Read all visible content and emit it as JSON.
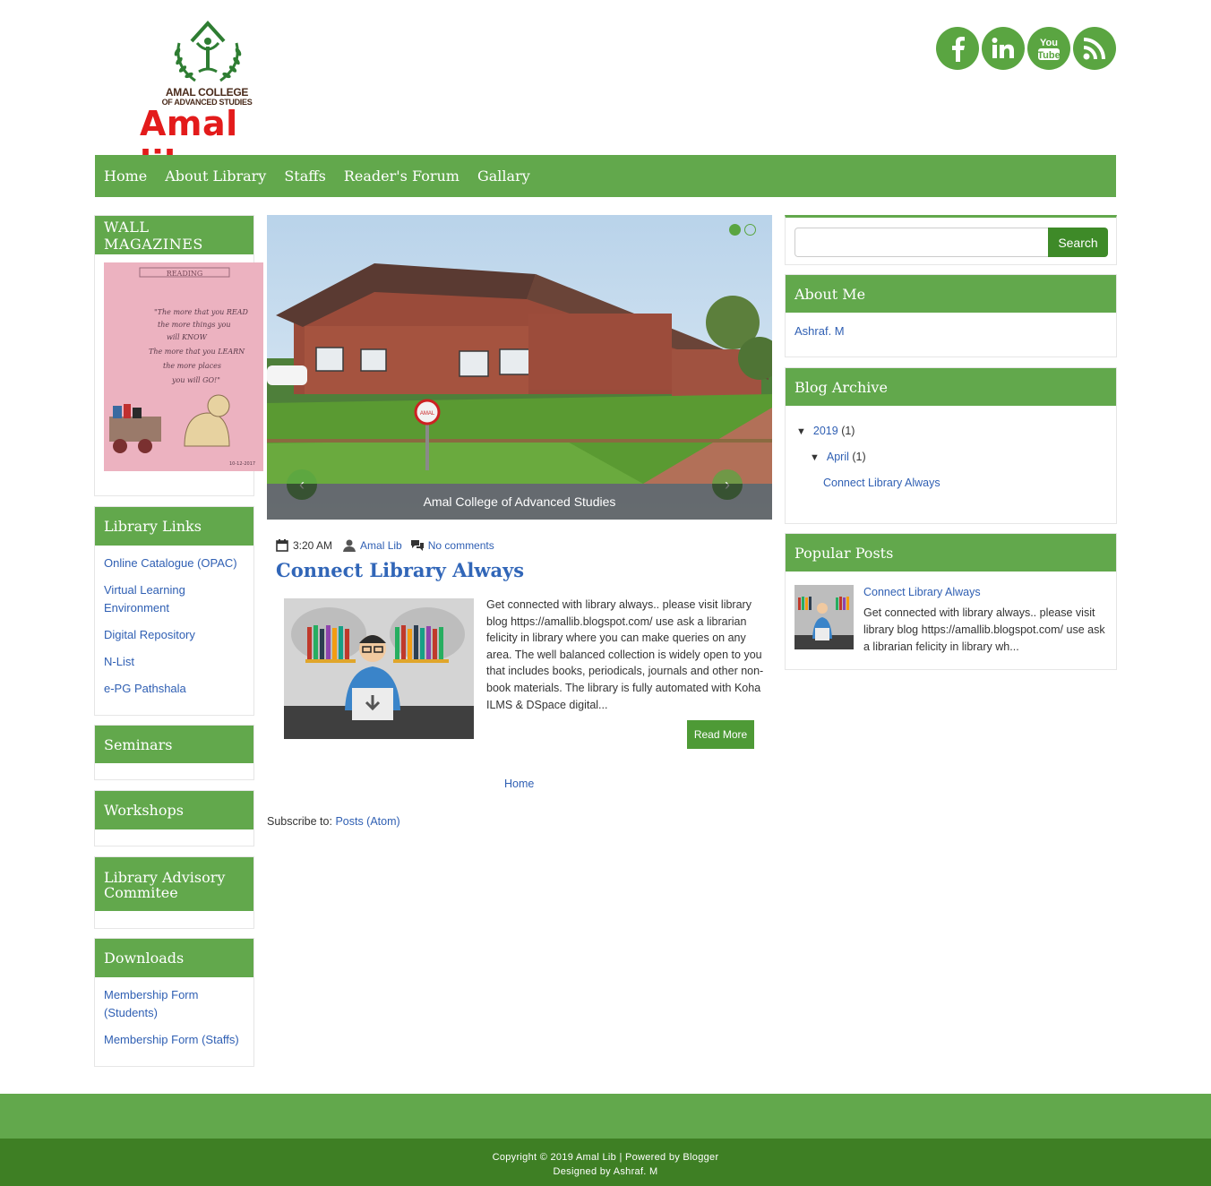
{
  "header": {
    "college_line1": "AMAL COLLEGE",
    "college_line2": "OF ADVANCED STUDIES",
    "site_name": "Amal lib",
    "social": [
      {
        "icon": "facebook-icon",
        "glyph": "f"
      },
      {
        "icon": "linkedin-icon",
        "glyph": "in"
      },
      {
        "icon": "youtube-icon",
        "glyph": "You Tube"
      },
      {
        "icon": "rss-icon",
        "glyph": ""
      }
    ]
  },
  "nav": {
    "items": [
      "Home",
      "About Library",
      "Staffs",
      "Reader's Forum",
      "Gallary"
    ]
  },
  "left": {
    "wall_magazines": {
      "title": "WALL MAGAZINES",
      "poster_heading": "READING",
      "poster_lines": [
        "\"The more that you READ",
        "the more things you",
        "will KNOW",
        "The more that you LEARN",
        "the more places",
        "you will GO!\""
      ]
    },
    "library_links": {
      "title": "Library Links",
      "items": [
        "Online Catalogue (OPAC)",
        "Virtual Learning Environment",
        "Digital Repository",
        "N-List",
        "e-PG Pathshala"
      ]
    },
    "seminars": {
      "title": "Seminars"
    },
    "workshops": {
      "title": "Workshops"
    },
    "advisory": {
      "title": "Library Advisory Commitee"
    },
    "downloads": {
      "title": "Downloads",
      "items": [
        "Membership Form (Students)",
        "Membership Form (Staffs)"
      ]
    }
  },
  "slider": {
    "caption": "Amal College of Advanced Studies",
    "sign_text": "AMAL",
    "prev": "‹",
    "next": "›"
  },
  "post": {
    "time": "3:20 AM",
    "author": "Amal Lib",
    "comments": "No comments",
    "title": "Connect Library Always",
    "excerpt": "Get connected with library always.. please visit library blog  https://amallib.blogspot.com/ use ask a librarian felicity in library where you can make queries on any area. The well balanced collection is widely open to you that includes books, periodicals, journals and other non-book materials. The library is fully automated with Koha ILMS & DSpace digital...",
    "read_more": "Read More",
    "home_link": "Home",
    "subscribe_label": "Subscribe to: ",
    "subscribe_link": "Posts (Atom)"
  },
  "right": {
    "search": {
      "button": "Search",
      "placeholder": ""
    },
    "about": {
      "title": "About Me",
      "name": "Ashraf. M"
    },
    "archive": {
      "title": "Blog Archive",
      "year": "2019",
      "year_count": "(1)",
      "month": "April",
      "month_count": "(1)",
      "post": "Connect Library Always",
      "toggle": "▼"
    },
    "popular": {
      "title": "Popular Posts",
      "post_title": "Connect Library Always",
      "snippet": "Get connected with library always.. please visit library blog  https://amallib.blogspot.com/ use ask a librarian felicity in library wh..."
    }
  },
  "footer": {
    "line1": "Copyright © 2019 Amal Lib | Powered by Blogger",
    "line2": "Designed by Ashraf. M"
  },
  "colors": {
    "brand_green": "#62a84c",
    "dark_green": "#3e7f24",
    "link_blue": "#2f5fb3",
    "logo_red": "#e31b1b"
  }
}
